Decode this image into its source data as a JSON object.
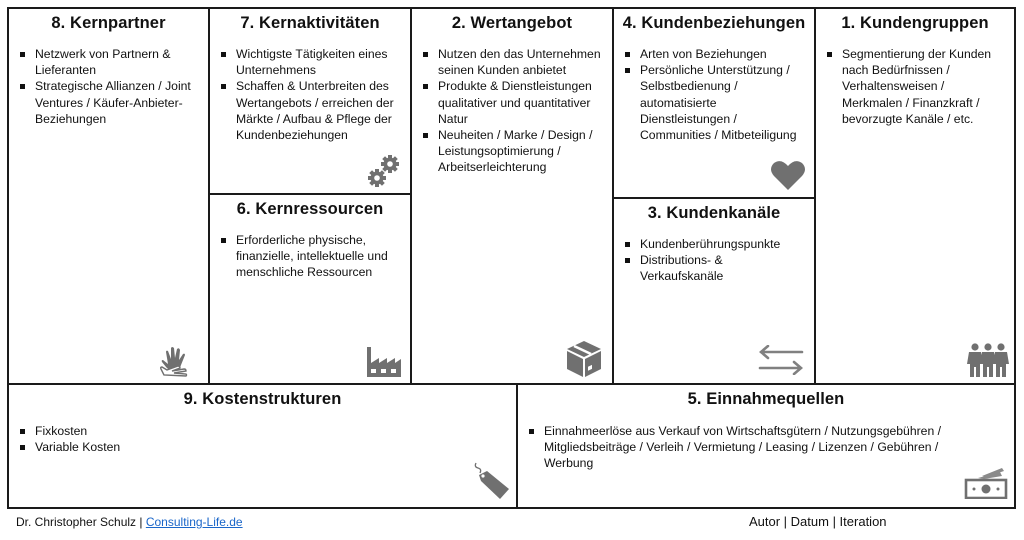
{
  "canvas": {
    "blocks": {
      "kernpartner": {
        "title": "8. Kernpartner",
        "items": [
          "Netzwerk von Partnern & Lieferanten",
          "Strategische Allianzen / Joint Ventures / Käufer-Anbieter-Beziehungen"
        ],
        "icon": "sign-language-hands-icon"
      },
      "kernaktivitaeten": {
        "title": "7. Kernaktivitäten",
        "items": [
          "Wichtigste Tätigkeiten eines Unternehmens",
          "Schaffen & Unterbreiten des Wertangebots / erreichen der Märkte / Aufbau & Pflege der Kundenbeziehungen"
        ],
        "icon": "gears-icon"
      },
      "kernressourcen": {
        "title": "6. Kernressourcen",
        "items": [
          "Erforderliche physische, finanzielle, intellektuelle und menschliche Ressourcen"
        ],
        "icon": "factory-icon"
      },
      "wertangebot": {
        "title": "2. Wertangebot",
        "items": [
          "Nutzen den das Unternehmen seinen Kunden anbietet",
          "Produkte & Dienstleistungen qualitativer und quantitativer Natur",
          "Neuheiten / Marke / Design / Leistungsoptimierung / Arbeitserleichterung"
        ],
        "icon": "package-box-icon"
      },
      "kundenbeziehungen": {
        "title": "4. Kundenbeziehungen",
        "items": [
          "Arten von Beziehungen",
          "Persönliche Unterstützung / Selbstbedienung / automatisierte Dienstleistungen / Communities / Mitbeteiligung"
        ],
        "icon": "heart-icon"
      },
      "kundenkanaele": {
        "title": "3. Kundenkanäle",
        "items": [
          "Kundenberührungspunkte",
          "Distributions- & Verkaufskanäle"
        ],
        "icon": "exchange-arrows-icon"
      },
      "kundengruppen": {
        "title": "1. Kundengruppen",
        "items": [
          "Segmentierung der Kunden nach Bedürfnissen / Verhaltensweisen / Merkmalen / Finanzkraft / bevorzugte Kanäle / etc."
        ],
        "icon": "people-group-icon"
      },
      "kostenstrukturen": {
        "title": "9. Kostenstrukturen",
        "items": [
          "Fixkosten",
          "Variable Kosten"
        ],
        "icon": "price-tag-icon"
      },
      "einnahmequellen": {
        "title": "5. Einnahmequellen",
        "items": [
          "Einnahmeerlöse aus Verkauf von Wirtschaftsgütern / Nutzungsgebühren / Mitgliedsbeiträge / Verleih / Vermietung / Leasing / Lizenzen / Gebühren / Werbung"
        ],
        "icon": "money-bills-icon"
      }
    }
  },
  "footer": {
    "author_prefix": "Dr. Christopher Schulz | ",
    "link_text": "Consulting-Life.de",
    "meta": "Autor | Datum | Iteration"
  },
  "colors": {
    "border": "#1a1a1a",
    "icon": "#6e6e6e",
    "link": "#1a66c9"
  }
}
